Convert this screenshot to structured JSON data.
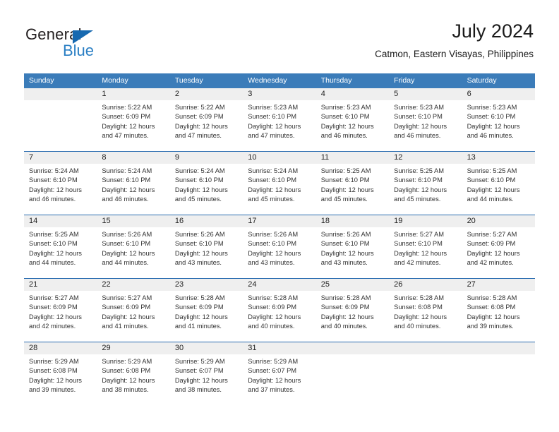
{
  "brand": {
    "name_top": "General",
    "name_bottom": "Blue",
    "triangle_color": "#1769b0",
    "blue_text_color": "#2a7fc4"
  },
  "header": {
    "title": "July 2024",
    "location": "Catmon, Eastern Visayas, Philippines"
  },
  "theme": {
    "header_row_bg": "#3b7cb9",
    "header_row_text": "#ffffff",
    "week_divider": "#2a6db0",
    "daynum_bg": "#efefef",
    "body_text": "#313131"
  },
  "calendar": {
    "weekdays": [
      "Sunday",
      "Monday",
      "Tuesday",
      "Wednesday",
      "Thursday",
      "Friday",
      "Saturday"
    ],
    "weeks": [
      [
        {
          "day": "",
          "sunrise": "",
          "sunset": "",
          "daylight_line1": "",
          "daylight_line2": "",
          "empty": true
        },
        {
          "day": "1",
          "sunrise": "Sunrise: 5:22 AM",
          "sunset": "Sunset: 6:09 PM",
          "daylight_line1": "Daylight: 12 hours",
          "daylight_line2": "and 47 minutes.",
          "empty": false
        },
        {
          "day": "2",
          "sunrise": "Sunrise: 5:22 AM",
          "sunset": "Sunset: 6:09 PM",
          "daylight_line1": "Daylight: 12 hours",
          "daylight_line2": "and 47 minutes.",
          "empty": false
        },
        {
          "day": "3",
          "sunrise": "Sunrise: 5:23 AM",
          "sunset": "Sunset: 6:10 PM",
          "daylight_line1": "Daylight: 12 hours",
          "daylight_line2": "and 47 minutes.",
          "empty": false
        },
        {
          "day": "4",
          "sunrise": "Sunrise: 5:23 AM",
          "sunset": "Sunset: 6:10 PM",
          "daylight_line1": "Daylight: 12 hours",
          "daylight_line2": "and 46 minutes.",
          "empty": false
        },
        {
          "day": "5",
          "sunrise": "Sunrise: 5:23 AM",
          "sunset": "Sunset: 6:10 PM",
          "daylight_line1": "Daylight: 12 hours",
          "daylight_line2": "and 46 minutes.",
          "empty": false
        },
        {
          "day": "6",
          "sunrise": "Sunrise: 5:23 AM",
          "sunset": "Sunset: 6:10 PM",
          "daylight_line1": "Daylight: 12 hours",
          "daylight_line2": "and 46 minutes.",
          "empty": false
        }
      ],
      [
        {
          "day": "7",
          "sunrise": "Sunrise: 5:24 AM",
          "sunset": "Sunset: 6:10 PM",
          "daylight_line1": "Daylight: 12 hours",
          "daylight_line2": "and 46 minutes.",
          "empty": false
        },
        {
          "day": "8",
          "sunrise": "Sunrise: 5:24 AM",
          "sunset": "Sunset: 6:10 PM",
          "daylight_line1": "Daylight: 12 hours",
          "daylight_line2": "and 46 minutes.",
          "empty": false
        },
        {
          "day": "9",
          "sunrise": "Sunrise: 5:24 AM",
          "sunset": "Sunset: 6:10 PM",
          "daylight_line1": "Daylight: 12 hours",
          "daylight_line2": "and 45 minutes.",
          "empty": false
        },
        {
          "day": "10",
          "sunrise": "Sunrise: 5:24 AM",
          "sunset": "Sunset: 6:10 PM",
          "daylight_line1": "Daylight: 12 hours",
          "daylight_line2": "and 45 minutes.",
          "empty": false
        },
        {
          "day": "11",
          "sunrise": "Sunrise: 5:25 AM",
          "sunset": "Sunset: 6:10 PM",
          "daylight_line1": "Daylight: 12 hours",
          "daylight_line2": "and 45 minutes.",
          "empty": false
        },
        {
          "day": "12",
          "sunrise": "Sunrise: 5:25 AM",
          "sunset": "Sunset: 6:10 PM",
          "daylight_line1": "Daylight: 12 hours",
          "daylight_line2": "and 45 minutes.",
          "empty": false
        },
        {
          "day": "13",
          "sunrise": "Sunrise: 5:25 AM",
          "sunset": "Sunset: 6:10 PM",
          "daylight_line1": "Daylight: 12 hours",
          "daylight_line2": "and 44 minutes.",
          "empty": false
        }
      ],
      [
        {
          "day": "14",
          "sunrise": "Sunrise: 5:25 AM",
          "sunset": "Sunset: 6:10 PM",
          "daylight_line1": "Daylight: 12 hours",
          "daylight_line2": "and 44 minutes.",
          "empty": false
        },
        {
          "day": "15",
          "sunrise": "Sunrise: 5:26 AM",
          "sunset": "Sunset: 6:10 PM",
          "daylight_line1": "Daylight: 12 hours",
          "daylight_line2": "and 44 minutes.",
          "empty": false
        },
        {
          "day": "16",
          "sunrise": "Sunrise: 5:26 AM",
          "sunset": "Sunset: 6:10 PM",
          "daylight_line1": "Daylight: 12 hours",
          "daylight_line2": "and 43 minutes.",
          "empty": false
        },
        {
          "day": "17",
          "sunrise": "Sunrise: 5:26 AM",
          "sunset": "Sunset: 6:10 PM",
          "daylight_line1": "Daylight: 12 hours",
          "daylight_line2": "and 43 minutes.",
          "empty": false
        },
        {
          "day": "18",
          "sunrise": "Sunrise: 5:26 AM",
          "sunset": "Sunset: 6:10 PM",
          "daylight_line1": "Daylight: 12 hours",
          "daylight_line2": "and 43 minutes.",
          "empty": false
        },
        {
          "day": "19",
          "sunrise": "Sunrise: 5:27 AM",
          "sunset": "Sunset: 6:10 PM",
          "daylight_line1": "Daylight: 12 hours",
          "daylight_line2": "and 42 minutes.",
          "empty": false
        },
        {
          "day": "20",
          "sunrise": "Sunrise: 5:27 AM",
          "sunset": "Sunset: 6:09 PM",
          "daylight_line1": "Daylight: 12 hours",
          "daylight_line2": "and 42 minutes.",
          "empty": false
        }
      ],
      [
        {
          "day": "21",
          "sunrise": "Sunrise: 5:27 AM",
          "sunset": "Sunset: 6:09 PM",
          "daylight_line1": "Daylight: 12 hours",
          "daylight_line2": "and 42 minutes.",
          "empty": false
        },
        {
          "day": "22",
          "sunrise": "Sunrise: 5:27 AM",
          "sunset": "Sunset: 6:09 PM",
          "daylight_line1": "Daylight: 12 hours",
          "daylight_line2": "and 41 minutes.",
          "empty": false
        },
        {
          "day": "23",
          "sunrise": "Sunrise: 5:28 AM",
          "sunset": "Sunset: 6:09 PM",
          "daylight_line1": "Daylight: 12 hours",
          "daylight_line2": "and 41 minutes.",
          "empty": false
        },
        {
          "day": "24",
          "sunrise": "Sunrise: 5:28 AM",
          "sunset": "Sunset: 6:09 PM",
          "daylight_line1": "Daylight: 12 hours",
          "daylight_line2": "and 40 minutes.",
          "empty": false
        },
        {
          "day": "25",
          "sunrise": "Sunrise: 5:28 AM",
          "sunset": "Sunset: 6:09 PM",
          "daylight_line1": "Daylight: 12 hours",
          "daylight_line2": "and 40 minutes.",
          "empty": false
        },
        {
          "day": "26",
          "sunrise": "Sunrise: 5:28 AM",
          "sunset": "Sunset: 6:08 PM",
          "daylight_line1": "Daylight: 12 hours",
          "daylight_line2": "and 40 minutes.",
          "empty": false
        },
        {
          "day": "27",
          "sunrise": "Sunrise: 5:28 AM",
          "sunset": "Sunset: 6:08 PM",
          "daylight_line1": "Daylight: 12 hours",
          "daylight_line2": "and 39 minutes.",
          "empty": false
        }
      ],
      [
        {
          "day": "28",
          "sunrise": "Sunrise: 5:29 AM",
          "sunset": "Sunset: 6:08 PM",
          "daylight_line1": "Daylight: 12 hours",
          "daylight_line2": "and 39 minutes.",
          "empty": false
        },
        {
          "day": "29",
          "sunrise": "Sunrise: 5:29 AM",
          "sunset": "Sunset: 6:08 PM",
          "daylight_line1": "Daylight: 12 hours",
          "daylight_line2": "and 38 minutes.",
          "empty": false
        },
        {
          "day": "30",
          "sunrise": "Sunrise: 5:29 AM",
          "sunset": "Sunset: 6:07 PM",
          "daylight_line1": "Daylight: 12 hours",
          "daylight_line2": "and 38 minutes.",
          "empty": false
        },
        {
          "day": "31",
          "sunrise": "Sunrise: 5:29 AM",
          "sunset": "Sunset: 6:07 PM",
          "daylight_line1": "Daylight: 12 hours",
          "daylight_line2": "and 37 minutes.",
          "empty": false
        },
        {
          "day": "",
          "sunrise": "",
          "sunset": "",
          "daylight_line1": "",
          "daylight_line2": "",
          "empty": true
        },
        {
          "day": "",
          "sunrise": "",
          "sunset": "",
          "daylight_line1": "",
          "daylight_line2": "",
          "empty": true
        },
        {
          "day": "",
          "sunrise": "",
          "sunset": "",
          "daylight_line1": "",
          "daylight_line2": "",
          "empty": true
        }
      ]
    ]
  }
}
